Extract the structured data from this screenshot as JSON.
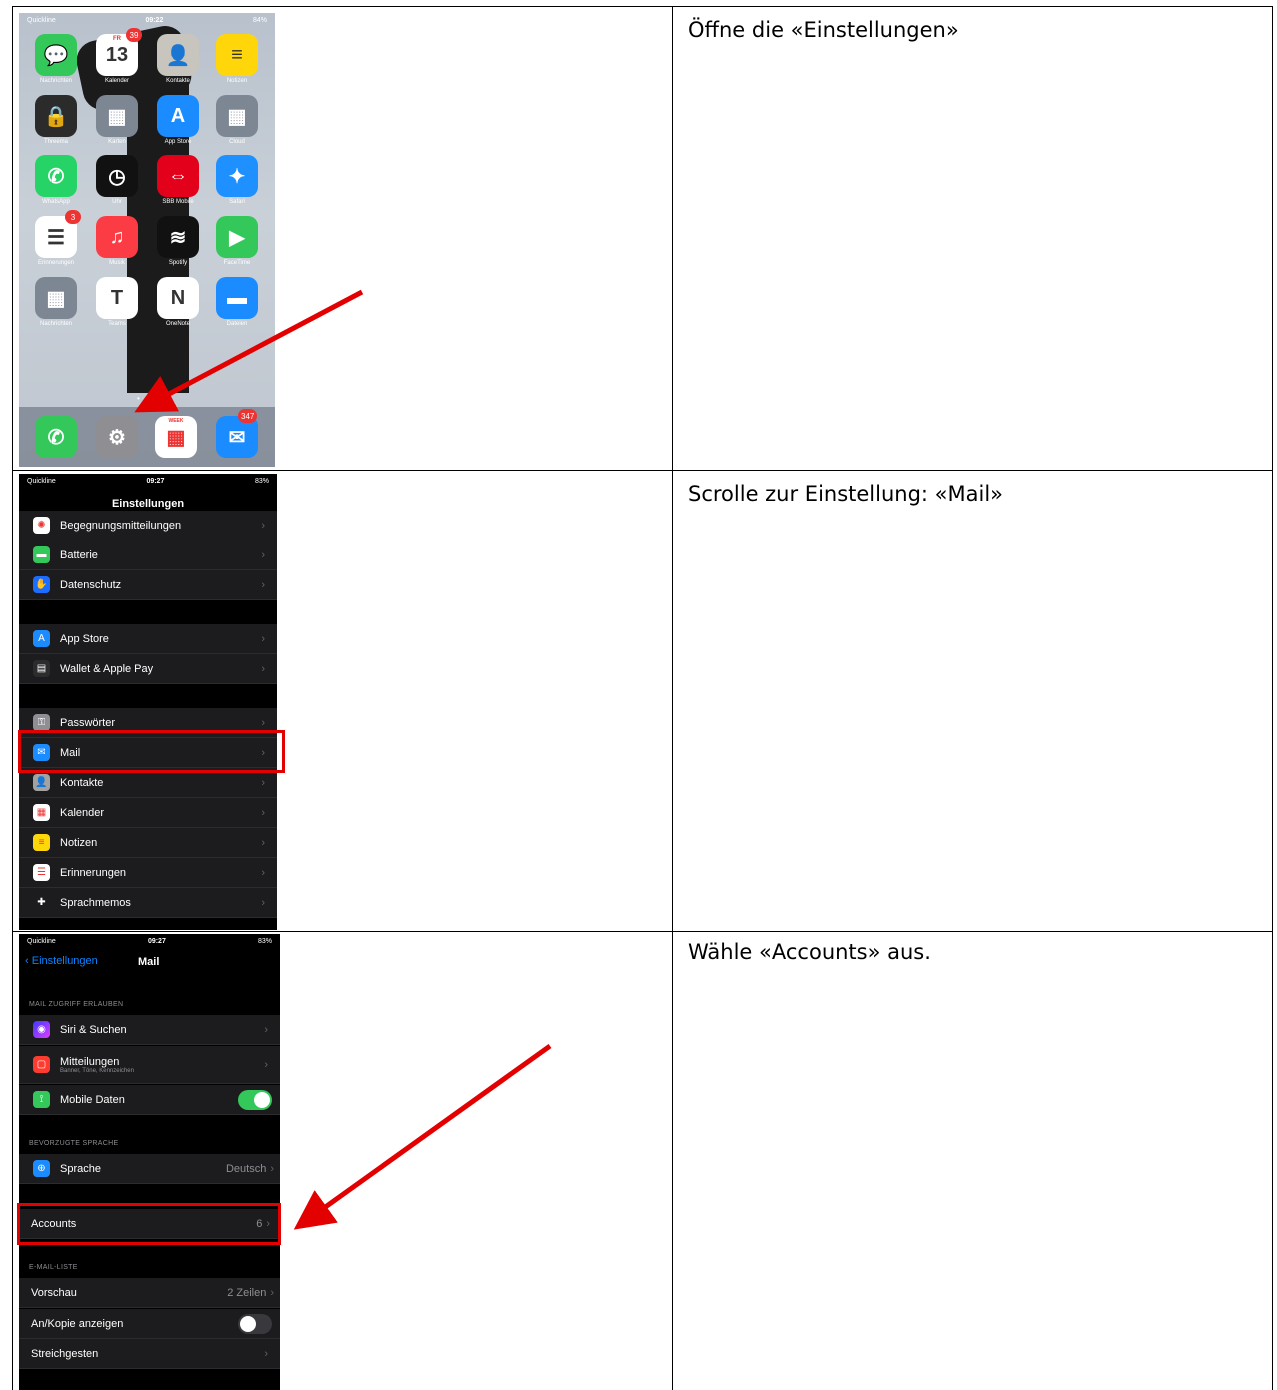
{
  "steps": [
    {
      "instruction": "Öffne die «Einstellungen»"
    },
    {
      "instruction": "Scrolle zur Einstellung: «Mail»"
    },
    {
      "instruction": "Wähle «Accounts» aus."
    }
  ],
  "home": {
    "status": {
      "carrier": "Quickline",
      "time": "09:22",
      "battery": "84%"
    },
    "apps": [
      {
        "label": "Nachrichten",
        "color": "#34c759",
        "glyph": "💬",
        "icon": "messages-icon"
      },
      {
        "label": "Kalender",
        "color": "#ffffff",
        "glyph": "13",
        "icon": "calendar-icon",
        "badge": "39",
        "sub": "FR"
      },
      {
        "label": "Kontakte",
        "color": "#c8c4be",
        "glyph": "👤",
        "icon": "contacts-icon"
      },
      {
        "label": "Notizen",
        "color": "#ffd60a",
        "glyph": "≡",
        "icon": "notes-icon"
      },
      {
        "label": "Threema",
        "color": "#2b2b2b",
        "glyph": "🔒",
        "icon": "threema-icon"
      },
      {
        "label": "Karten",
        "color": "#7d8794",
        "glyph": "▦",
        "icon": "maps-folder-icon"
      },
      {
        "label": "App Store",
        "color": "#1a8cff",
        "glyph": "A",
        "icon": "app-store-icon"
      },
      {
        "label": "Cloud",
        "color": "#7d8794",
        "glyph": "▦",
        "icon": "cloud-folder-icon"
      },
      {
        "label": "WhatsApp",
        "color": "#25d366",
        "glyph": "✆",
        "icon": "whatsapp-icon"
      },
      {
        "label": "Uhr",
        "color": "#111111",
        "glyph": "◷",
        "icon": "clock-icon"
      },
      {
        "label": "SBB Mobile",
        "color": "#e2001a",
        "glyph": "⇔",
        "icon": "sbb-icon"
      },
      {
        "label": "Safari",
        "color": "#1e90ff",
        "glyph": "✦",
        "icon": "safari-icon"
      },
      {
        "label": "Erinnerungen",
        "color": "#ffffff",
        "glyph": "☰",
        "icon": "reminders-icon",
        "badge": "3"
      },
      {
        "label": "Musik",
        "color": "#fc3c44",
        "glyph": "♫",
        "icon": "music-icon"
      },
      {
        "label": "Spotify",
        "color": "#111111",
        "glyph": "≋",
        "icon": "spotify-icon"
      },
      {
        "label": "FaceTime",
        "color": "#34c759",
        "glyph": "▶",
        "icon": "facetime-icon"
      },
      {
        "label": "Nachrichten",
        "color": "#7d8794",
        "glyph": "▦",
        "icon": "news-folder-icon"
      },
      {
        "label": "Teams",
        "color": "#ffffff",
        "glyph": "T",
        "icon": "teams-icon"
      },
      {
        "label": "OneNote",
        "color": "#ffffff",
        "glyph": "N",
        "icon": "onenote-icon"
      },
      {
        "label": "Dateien",
        "color": "#1a8cff",
        "glyph": "▬",
        "icon": "files-icon"
      }
    ],
    "dock": [
      {
        "color": "#34c759",
        "glyph": "✆",
        "icon": "phone-icon"
      },
      {
        "color": "#8e8e93",
        "glyph": "⚙",
        "icon": "settings-icon"
      },
      {
        "color": "#ffffff",
        "glyph": "▦",
        "icon": "week-calendar-icon",
        "sub": "WEEK"
      },
      {
        "color": "#1a8cff",
        "glyph": "✉",
        "icon": "mail-icon",
        "badge": "347"
      }
    ]
  },
  "settings": {
    "status": {
      "carrier": "Quickline",
      "time": "09:27",
      "battery": "83%"
    },
    "title": "Einstellungen",
    "rows": [
      {
        "label": "Begegnungsmitteilungen",
        "color": "#ffffff",
        "glyph": "✺",
        "icon": "exposure-icon"
      },
      {
        "label": "Batterie",
        "color": "#34c759",
        "glyph": "▬",
        "icon": "battery-icon"
      },
      {
        "label": "Datenschutz",
        "color": "#1a6dff",
        "glyph": "✋",
        "icon": "privacy-icon"
      },
      {
        "label": "App Store",
        "color": "#1a8cff",
        "glyph": "A",
        "icon": "app-store-icon"
      },
      {
        "label": "Wallet & Apple Pay",
        "color": "#2c2c2e",
        "glyph": "▤",
        "icon": "wallet-icon"
      },
      {
        "label": "Passwörter",
        "color": "#8e8e93",
        "glyph": "⚿",
        "icon": "key-icon"
      },
      {
        "label": "Mail",
        "color": "#1a8cff",
        "glyph": "✉",
        "icon": "mail-icon"
      },
      {
        "label": "Kontakte",
        "color": "#a2a2a2",
        "glyph": "👤",
        "icon": "contacts-icon"
      },
      {
        "label": "Kalender",
        "color": "#ffffff",
        "glyph": "▦",
        "icon": "calendar-icon"
      },
      {
        "label": "Notizen",
        "color": "#ffd60a",
        "glyph": "≡",
        "icon": "notes-icon"
      },
      {
        "label": "Erinnerungen",
        "color": "#ffffff",
        "glyph": "☰",
        "icon": "reminders-icon"
      },
      {
        "label": "Sprachmemos",
        "color": "#1c1c1e",
        "glyph": "✚",
        "icon": "voice-memos-icon"
      }
    ]
  },
  "mail": {
    "status": {
      "carrier": "Quickline",
      "time": "09:27",
      "battery": "83%"
    },
    "back_label": "Einstellungen",
    "title": "Mail",
    "section_access": "MAIL ZUGRIFF ERLAUBEN",
    "siri": "Siri & Suchen",
    "notifications": "Mitteilungen",
    "notifications_sub": "Banner, Töne, Kennzeichen",
    "mobile_data": "Mobile Daten",
    "mobile_data_on": true,
    "section_language": "BEVORZUGTE SPRACHE",
    "language": "Sprache",
    "language_value": "Deutsch",
    "accounts": "Accounts",
    "accounts_count": "6",
    "section_list": "E-MAIL-LISTE",
    "preview": "Vorschau",
    "preview_value": "2 Zeilen",
    "cc_label": "An/Kopie anzeigen",
    "cc_on": false,
    "swipe": "Streichgesten"
  },
  "colors": {
    "highlight": "#e30000",
    "arrow": "#e30000"
  }
}
